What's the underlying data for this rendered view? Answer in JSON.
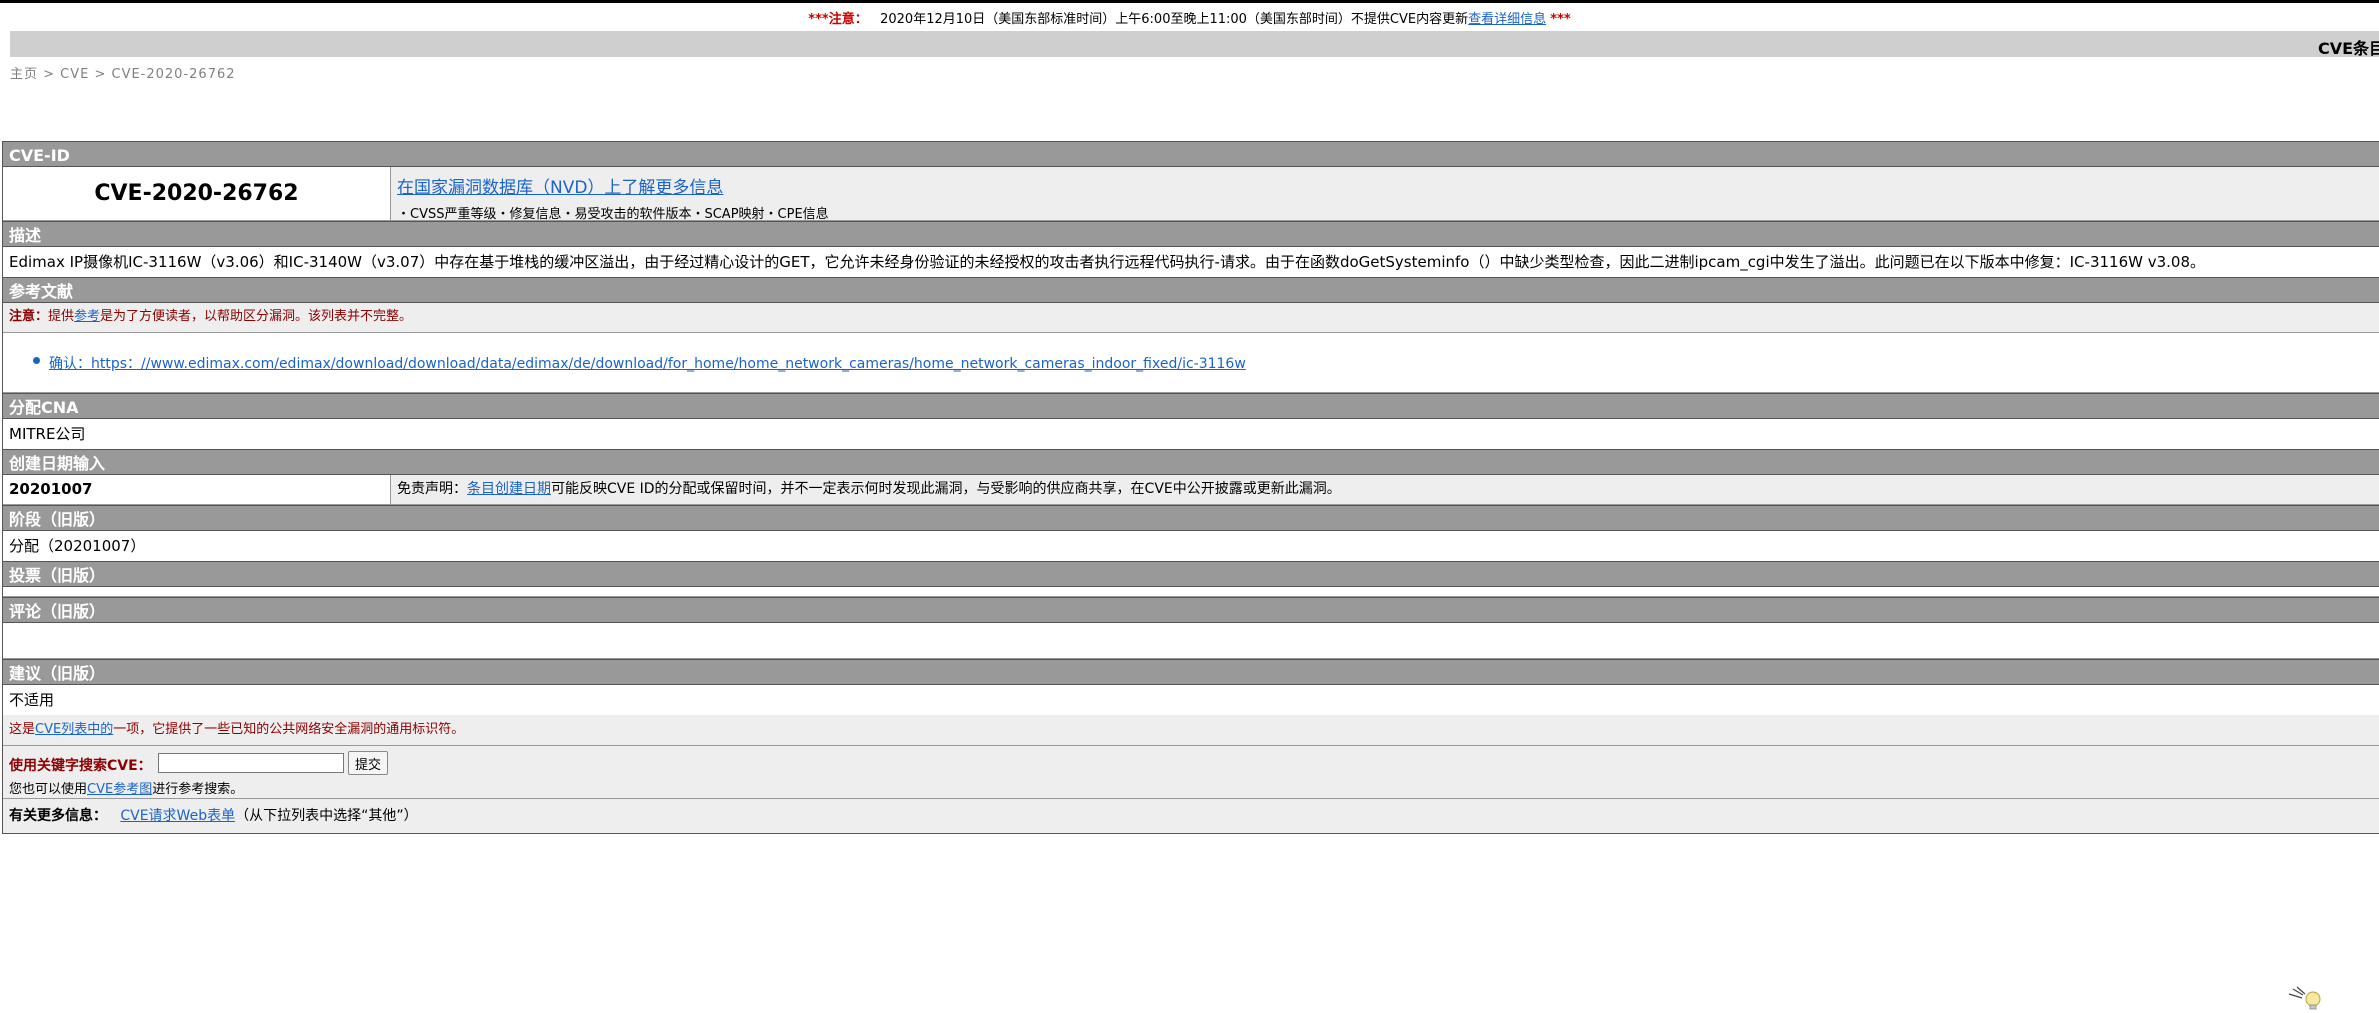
{
  "notice": {
    "stars_prefix": "***注意：",
    "text": "2020年12月10日（美国东部标准时间）上午6:00至晚上11:00（美国东部时间）不提供CVE内容更新",
    "link": "查看详细信息",
    "stars_suffix": "***"
  },
  "header": {
    "title": "CVE条目"
  },
  "breadcrumb": "主页 > CVE > CVE-2020-26762",
  "cve": {
    "id_header": "CVE-ID",
    "id": "CVE-2020-26762",
    "nvd_link": "在国家漏洞数据库（NVD）上了解更多信息",
    "nvd_sub": "・CVSS严重等级・修复信息・易受攻击的软件版本・SCAP映射・CPE信息"
  },
  "description": {
    "header": "描述",
    "text": "Edimax IP摄像机IC-3116W（v3.06）和IC-3140W（v3.07）中存在基于堆栈的缓冲区溢出，由于经过精心设计的GET，它允许未经身份验证的未经授权的攻击者执行远程代码执行-请求。由于在函数doGetSysteminfo（）中缺少类型检查，因此二进制ipcam_cgi中发生了溢出。此问题已在以下版本中修复：IC-3116W v3.08。"
  },
  "references": {
    "header": "参考文献",
    "note_bold": "注意：",
    "note_pre": "提供",
    "note_link": "参考",
    "note_post": "是为了方便读者，以帮助区分漏洞。该列表并不完整。",
    "items": [
      "确认：https：//www.edimax.com/edimax/download/download/data/edimax/de/download/for_home/home_network_cameras/home_network_cameras_indoor_fixed/ic-3116w"
    ]
  },
  "cna": {
    "header": "分配CNA",
    "value": "MITRE公司"
  },
  "date": {
    "header": "创建日期输入",
    "value": "20201007",
    "disclaimer_pre": "免责声明：",
    "disclaimer_link": "条目创建日期",
    "disclaimer_post": "可能反映CVE ID的分配或保留时间，并不一定表示何时发现此漏洞，与受影响的供应商共享，在CVE中公开披露或更新此漏洞。"
  },
  "phase": {
    "header": "阶段（旧版）",
    "value": "分配（20201007）"
  },
  "votes": {
    "header": "投票（旧版）"
  },
  "comments": {
    "header": "评论（旧版）"
  },
  "proposal": {
    "header": "建议（旧版）",
    "value": "不适用"
  },
  "footer": {
    "list_pre": "这是",
    "list_link": "CVE列表中的",
    "list_post": "一项，它提供了一些已知的公共网络安全漏洞的通用标识符。",
    "search_label": "使用关键字搜索CVE：",
    "search_value": "",
    "submit_label": "提交",
    "ref_pre": "您也可以使用",
    "ref_link": "CVE参考图",
    "ref_post": "进行参考搜索。",
    "more_label": "有关更多信息：",
    "more_link": "CVE请求Web表单",
    "more_post": "（从下拉列表中选择“其他”）"
  }
}
